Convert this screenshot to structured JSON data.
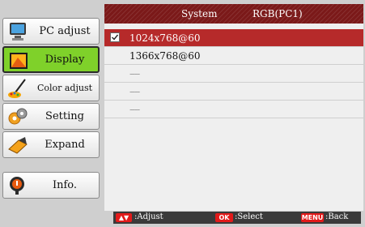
{
  "menu": {
    "items": [
      {
        "label": "PC adjust",
        "icon": "pc-adjust-icon",
        "active": false
      },
      {
        "label": "Display",
        "icon": "display-icon",
        "active": true
      },
      {
        "label": "Color adjust",
        "icon": "color-adjust-icon",
        "active": false
      },
      {
        "label": "Setting",
        "icon": "setting-icon",
        "active": false
      },
      {
        "label": "Expand",
        "icon": "expand-icon",
        "active": false
      },
      {
        "label": "Info.",
        "icon": "info-icon",
        "active": false
      }
    ]
  },
  "panel": {
    "header": {
      "system_label": "System",
      "system_value": "RGB(PC1)"
    },
    "rows": [
      {
        "text": "1024x768@60",
        "checked": true
      },
      {
        "text": "1366x768@60",
        "checked": false
      },
      {
        "text": "----",
        "checked": false
      },
      {
        "text": "----",
        "checked": false
      },
      {
        "text": "----",
        "checked": false
      }
    ]
  },
  "footer": {
    "adjust_key": "▲▼",
    "adjust_label": ":Adjust",
    "select_key": "OK",
    "select_label": ":Select",
    "back_key": "MENU",
    "back_label": ":Back"
  },
  "colors": {
    "header_bg": "#7b1919",
    "selected_row": "#b62a2a",
    "active_menu": "#7fd12a",
    "key_red": "#e21a1a"
  }
}
